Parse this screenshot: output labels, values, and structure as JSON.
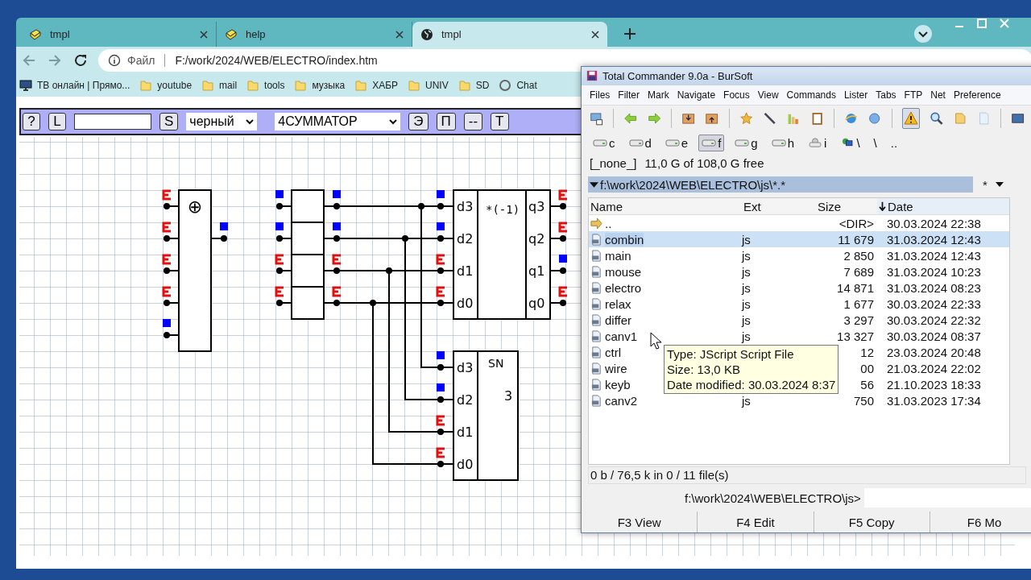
{
  "browser": {
    "tabs": [
      {
        "title": "tmpl",
        "kind": "book",
        "selected": false
      },
      {
        "title": "help",
        "kind": "book",
        "selected": false
      },
      {
        "title": "tmpl",
        "kind": "globe",
        "selected": true
      }
    ],
    "address": {
      "scheme_label": "Файл",
      "url": "F:/work/2024/WEB/ELECTRO/index.htm"
    },
    "bookmarks": [
      {
        "label": "ТВ онлайн | Прямо...",
        "kind": "monitor"
      },
      {
        "label": "youtube",
        "kind": "folder"
      },
      {
        "label": "mail",
        "kind": "folder"
      },
      {
        "label": "tools",
        "kind": "folder"
      },
      {
        "label": "музыка",
        "kind": "folder"
      },
      {
        "label": "ХАБР",
        "kind": "folder"
      },
      {
        "label": "UNIV",
        "kind": "folder"
      },
      {
        "label": "SD",
        "kind": "folder"
      },
      {
        "label": "Chat",
        "kind": "chat"
      }
    ]
  },
  "app": {
    "toolbar": [
      {
        "kind": "button",
        "label": "?"
      },
      {
        "kind": "button",
        "label": "L"
      },
      {
        "kind": "input"
      },
      {
        "kind": "button",
        "label": "S"
      },
      {
        "kind": "select",
        "value": "черный"
      },
      {
        "kind": "select",
        "value": "4СУММАТОР"
      },
      {
        "kind": "button",
        "label": "Э"
      },
      {
        "kind": "button",
        "label": "П"
      },
      {
        "kind": "button",
        "label": "--"
      },
      {
        "kind": "button",
        "label": "Т"
      }
    ]
  },
  "circuit": {
    "xor": {
      "symbol": "⊕",
      "inputs": [
        {
          "high": false
        },
        {
          "high": false
        },
        {
          "high": false
        },
        {
          "high": false
        },
        {
          "high": true
        }
      ],
      "output": {
        "high": true
      }
    },
    "register": {
      "inputs": [
        {
          "high": true
        },
        {
          "high": true
        },
        {
          "high": false
        },
        {
          "high": false
        }
      ],
      "outputs": [
        {
          "high": true
        },
        {
          "high": true
        },
        {
          "high": false
        },
        {
          "high": false
        }
      ]
    },
    "negator": {
      "function": "*(-1)",
      "inputs": [
        {
          "label": "d3",
          "high": true
        },
        {
          "label": "d2",
          "high": true
        },
        {
          "label": "d1",
          "high": false
        },
        {
          "label": "d0",
          "high": false
        }
      ],
      "outputs": [
        {
          "label": "q3",
          "high": false
        },
        {
          "label": "q2",
          "high": false
        },
        {
          "label": "q1",
          "high": true
        },
        {
          "label": "q0",
          "high": false
        }
      ]
    },
    "sn": {
      "title": "SN",
      "value": "3",
      "inputs": [
        {
          "label": "d3",
          "high": true
        },
        {
          "label": "d2",
          "high": true
        },
        {
          "label": "d1",
          "high": false
        },
        {
          "label": "d0",
          "high": false
        }
      ]
    }
  },
  "total_commander": {
    "title": "Total Commander 9.0a - BurSoft",
    "menu": [
      "Files",
      "Filter",
      "Mark",
      "Navigate",
      "Focus",
      "View",
      "Commands",
      "Lister",
      "Tabs",
      "FTP",
      "Net",
      "Preference"
    ],
    "drives": [
      {
        "label": "c",
        "kind": "disk",
        "selected": false
      },
      {
        "label": "d",
        "kind": "disk",
        "selected": false
      },
      {
        "label": "e",
        "kind": "disk",
        "selected": false
      },
      {
        "label": "f",
        "kind": "disk",
        "selected": true
      },
      {
        "label": "g",
        "kind": "disk",
        "selected": false
      },
      {
        "label": "h",
        "kind": "disk",
        "selected": false
      },
      {
        "label": "i",
        "kind": "removable",
        "selected": false
      },
      {
        "label": "\\",
        "kind": "network",
        "selected": false
      },
      {
        "label": "\\",
        "kind": "plain",
        "selected": false
      },
      {
        "label": "..",
        "kind": "plain",
        "selected": false
      }
    ],
    "drive_name": "[_none_]",
    "free_space": "11,0 G of 108,0 G free",
    "path": "f:\\work\\2024\\WEB\\ELECTRO\\js\\*.*",
    "filter": "*",
    "columns": [
      "Name",
      "Ext",
      "Size",
      "Date"
    ],
    "files": [
      {
        "kind": "up",
        "name": "..",
        "size": "<DIR>",
        "date": "30.03.2024 22:38",
        "selected": false
      },
      {
        "kind": "file",
        "name": "combin",
        "ext": "js",
        "size": "11 679",
        "date": "31.03.2024 12:43",
        "selected": true
      },
      {
        "kind": "file",
        "name": "main",
        "ext": "js",
        "size": "2 850",
        "date": "31.03.2024 12:43",
        "selected": false
      },
      {
        "kind": "file",
        "name": "mouse",
        "ext": "js",
        "size": "7 689",
        "date": "31.03.2024 10:23",
        "selected": false
      },
      {
        "kind": "file",
        "name": "electro",
        "ext": "js",
        "size": "14 871",
        "date": "31.03.2024 08:23",
        "selected": false
      },
      {
        "kind": "file",
        "name": "relax",
        "ext": "js",
        "size": "1 677",
        "date": "30.03.2024 22:33",
        "selected": false
      },
      {
        "kind": "file",
        "name": "differ",
        "ext": "js",
        "size": "3 297",
        "date": "30.03.2024 22:32",
        "selected": false
      },
      {
        "kind": "file",
        "name": "canv1",
        "ext": "js",
        "size": "13 327",
        "date": "30.03.2024 08:37",
        "selected": false
      },
      {
        "kind": "file",
        "name": "ctrl",
        "size": "12",
        "date": "23.03.2024 20:48",
        "selected": false
      },
      {
        "kind": "file",
        "name": "wire",
        "size": "00",
        "date": "21.03.2024 22:02",
        "selected": false
      },
      {
        "kind": "file",
        "name": "keyb",
        "size": "56",
        "date": "21.10.2023 18:33",
        "selected": false
      },
      {
        "kind": "file",
        "name": "canv2",
        "ext": "js",
        "size": "750",
        "date": "31.03.2023 17:34",
        "selected": false
      }
    ],
    "tooltip": [
      "Type: JScript Script File",
      "Size: 13,0 KB",
      "Date modified: 30.03.2024 8:37"
    ],
    "status": "0 b / 76,5 k in 0 / 11 file(s)",
    "command_prompt": "f:\\work\\2024\\WEB\\ELECTRO\\js>",
    "function_keys": [
      "F3 View",
      "F4 Edit",
      "F5 Copy",
      "F6 Mo"
    ]
  }
}
